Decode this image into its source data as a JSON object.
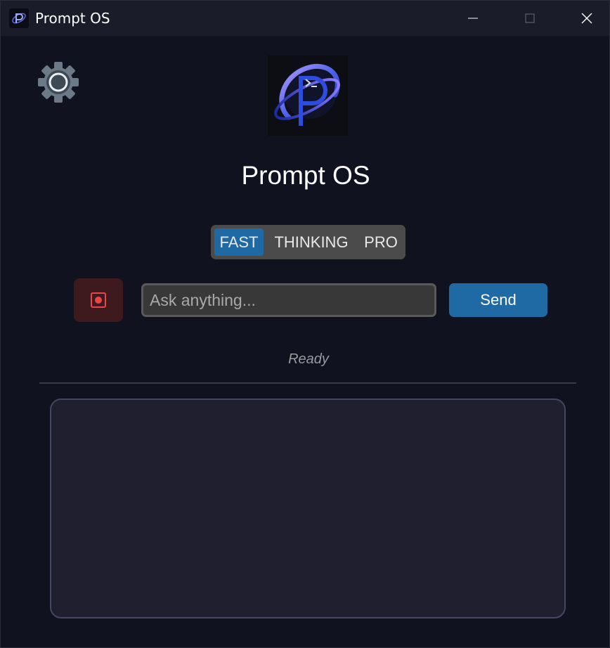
{
  "window": {
    "title": "Prompt OS",
    "controls": [
      "minimize-icon",
      "maximize-icon",
      "close-icon"
    ]
  },
  "header": {
    "settings_icon": "gear-icon",
    "logo_icon": "prompt-os-logo",
    "app_name": "Prompt OS"
  },
  "modes": {
    "selected": "FAST",
    "items": [
      {
        "label": "FAST",
        "active": true
      },
      {
        "label": "THINKING",
        "active": false
      },
      {
        "label": "PRO",
        "active": false
      }
    ]
  },
  "input_bar": {
    "record_icon": "record-icon",
    "placeholder": "Ask anything...",
    "value": "",
    "send_label": "Send"
  },
  "status": {
    "text": "Ready"
  },
  "colors": {
    "background": "#111220",
    "titlebar": "#1a1c2a",
    "accent": "#1f6aa5",
    "record": "#e84747",
    "output_bg": "#1f1f2f"
  }
}
